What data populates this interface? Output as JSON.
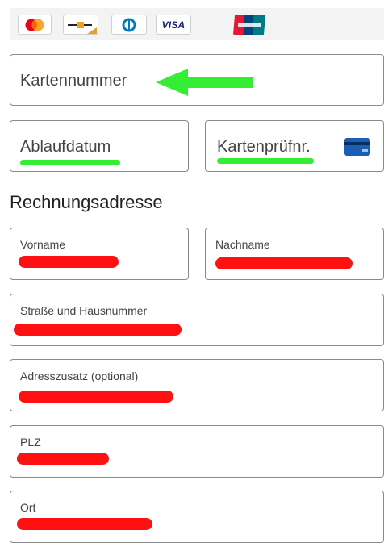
{
  "payment_methods": {
    "icons": [
      "mastercard-icon",
      "debit-card-icon",
      "diners-club-icon",
      "visa-icon",
      "unionpay-icon"
    ],
    "visa_label": "VISA",
    "unionpay_label": "UnionPay"
  },
  "card_number": {
    "label": "Kartennummer"
  },
  "expiry": {
    "label": "Ablaufdatum"
  },
  "cvc": {
    "label": "Kartenprüfnr."
  },
  "billing": {
    "heading": "Rechnungsadresse",
    "first_name": {
      "label": "Vorname"
    },
    "last_name": {
      "label": "Nachname"
    },
    "street": {
      "label": "Straße und Hausnummer"
    },
    "address_extra": {
      "label": "Adresszusatz (optional)"
    },
    "postal_code": {
      "label": "PLZ"
    },
    "city": {
      "label": "Ort"
    }
  },
  "colors": {
    "annotation_green": "#33ee33",
    "redaction_red": "#ff1111"
  }
}
